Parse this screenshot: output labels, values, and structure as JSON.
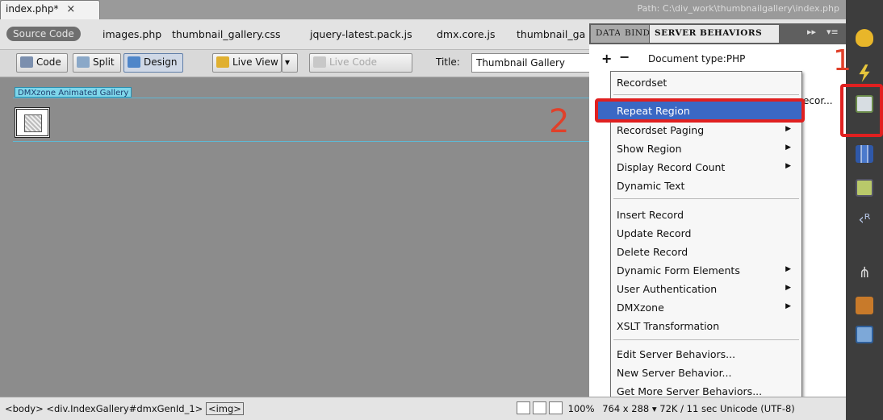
{
  "document_tab": {
    "label": "index.php*",
    "close": "×"
  },
  "path": "Path: C:\\div_work\\thumbnailgallery\\index.php",
  "related_files": {
    "source": "Source Code",
    "files": [
      "images.php",
      "thumbnail_gallery.css",
      "jquery-latest.pack.js",
      "dmx.core.js",
      "thumbnail_ga"
    ]
  },
  "toolbar": {
    "code": "Code",
    "split": "Split",
    "design": "Design",
    "live_view": "Live View",
    "live_code": "Live Code",
    "title_label": "Title:",
    "title_value": "Thumbnail Gallery"
  },
  "canvas": {
    "gallery_label": "DMXzone Animated Gallery",
    "annotation": "2"
  },
  "panel": {
    "tabs": [
      "DATA",
      "BIND",
      "SERVER BEHAVIORS"
    ],
    "expand": "▸▸",
    "menu": "▾≡",
    "plus": "+",
    "minus": "−",
    "doctype": "Document type:PHP",
    "item": "ecor..."
  },
  "menu": {
    "items": [
      {
        "label": "Recordset",
        "submenu": false
      },
      {
        "label": "Repeat Region",
        "submenu": false,
        "highlighted": true
      },
      {
        "label": "Recordset Paging",
        "submenu": true
      },
      {
        "label": "Show Region",
        "submenu": true
      },
      {
        "label": "Display Record Count",
        "submenu": true
      },
      {
        "label": "Dynamic Text",
        "submenu": false
      },
      {
        "label": "Insert Record",
        "submenu": false
      },
      {
        "label": "Update Record",
        "submenu": false
      },
      {
        "label": "Delete Record",
        "submenu": false
      },
      {
        "label": "Dynamic Form Elements",
        "submenu": true
      },
      {
        "label": "User Authentication",
        "submenu": true
      },
      {
        "label": "DMXzone",
        "submenu": true
      },
      {
        "label": "XSLT Transformation",
        "submenu": false
      },
      {
        "label": "Edit Server Behaviors...",
        "submenu": false
      },
      {
        "label": "New Server Behavior...",
        "submenu": false
      },
      {
        "label": "Get More Server Behaviors...",
        "submenu": false
      }
    ],
    "submenu_arrow": "▶"
  },
  "dock": {
    "annotation": "1",
    "icons": [
      "database-icon",
      "lightning-icon",
      "server-behaviors-icon",
      "chart-icon",
      "image-icon",
      "tag-inspector-icon",
      "sitemap-icon",
      "briefcase-icon",
      "snippet-icon"
    ]
  },
  "statusbar": {
    "tags": [
      "<body>",
      "<div.IndexGallery#dmxGenId_1>",
      "<img>"
    ],
    "zoom": "100%",
    "info": "764 x 288 ▾ 72K / 11 sec  Unicode (UTF-8)"
  },
  "colors": {
    "highlight": "#3a68c4",
    "annotation_red": "#e02020",
    "canvas": "#8c8c8c"
  }
}
